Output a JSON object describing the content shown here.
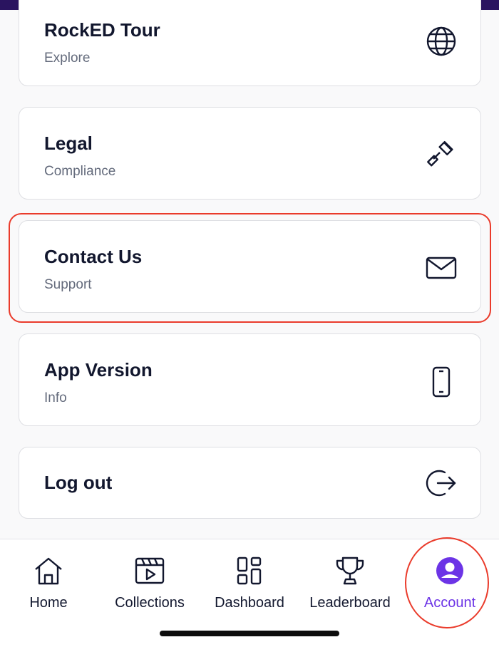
{
  "menu": {
    "items": [
      {
        "title": "RockED Tour",
        "subtitle": "Explore",
        "icon": "globe-icon"
      },
      {
        "title": "Legal",
        "subtitle": "Compliance",
        "icon": "gavel-icon"
      },
      {
        "title": "Contact Us",
        "subtitle": "Support",
        "icon": "envelope-icon"
      },
      {
        "title": "App Version",
        "subtitle": "Info",
        "icon": "phone-icon"
      },
      {
        "title": "Log out",
        "icon": "logout-icon"
      }
    ]
  },
  "tabbar": {
    "tabs": [
      {
        "label": "Home",
        "icon": "home-icon"
      },
      {
        "label": "Collections",
        "icon": "clapperboard-icon"
      },
      {
        "label": "Dashboard",
        "icon": "dashboard-grid-icon"
      },
      {
        "label": "Leaderboard",
        "icon": "trophy-icon"
      },
      {
        "label": "Account",
        "icon": "account-icon",
        "active": true
      }
    ]
  },
  "colors": {
    "accent": "#6c34e6",
    "highlight": "#ea3b2b",
    "text": "#12172e",
    "subtext": "#646b7c",
    "banner": "#2a1460"
  }
}
